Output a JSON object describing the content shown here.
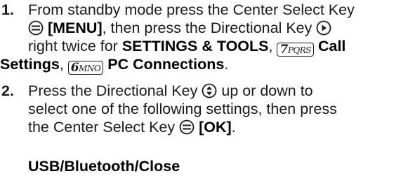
{
  "steps": [
    {
      "number": "1.",
      "l1_a": "From standby mode press the Center Select Key",
      "l2_b": "[MENU]",
      "l2_c": ", then press the Directional Key",
      "l3_a": "right twice for",
      "l3_b": "SETTINGS & TOOLS",
      "l3_c": ",",
      "l3_key": {
        "digit": "7",
        "letters": "PQRS"
      },
      "l3_d": "Call",
      "l4_a": "Settings",
      "l4_b": ",",
      "l4_key": {
        "digit": "6",
        "letters": "MNO"
      },
      "l4_c": "PC Connections",
      "l4_d": "."
    },
    {
      "number": "2.",
      "l1_a": "Press the Directional Key",
      "l1_b": "up or down to",
      "l2_a": "select one of the following settings, then press",
      "l3_a": "the Center Select Key",
      "l3_b": "[OK]",
      "l3_c": "."
    }
  ],
  "options_line": "USB/Bluetooth/Close",
  "icons": [
    "center-select-key-icon",
    "directional-key-right-icon",
    "directional-key-updown-icon",
    "key-7-pqrs-icon",
    "key-6-mno-icon"
  ]
}
